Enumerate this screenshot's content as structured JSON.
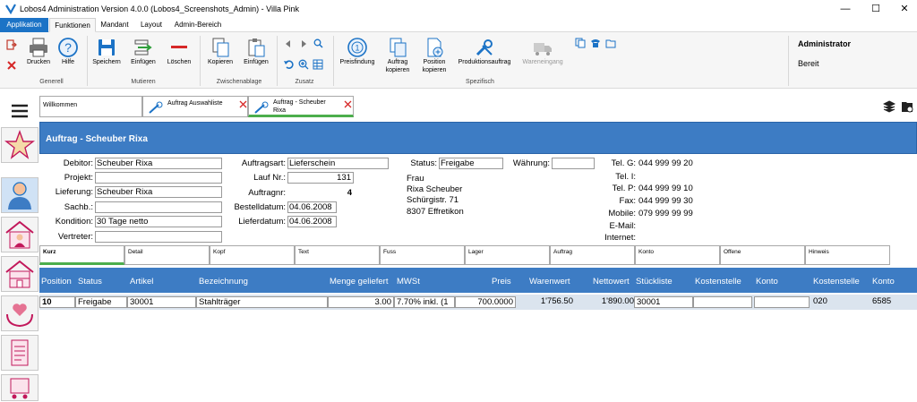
{
  "window": {
    "title": "Lobos4 Administration Version 4.0.0 (Lobos4_Screenshots_Admin) - Villa Pink",
    "minimize": "—",
    "maximize": "☐",
    "close": "✕"
  },
  "menu": {
    "tabs": [
      "Applikation",
      "Funktionen",
      "Mandant",
      "Layout",
      "Admin-Bereich"
    ]
  },
  "ribbon": {
    "buttons": {
      "drucken": "Drucken",
      "hilfe": "Hilfe",
      "speichern": "Speichern",
      "einfuegen": "Einfügen",
      "loeschen": "Löschen",
      "kopieren": "Kopieren",
      "einfuegen2": "Einfügen",
      "preisfindung": "Preisfindung",
      "auftrag_kopieren_1": "Auftrag",
      "auftrag_kopieren_2": "kopieren",
      "position_kopieren_1": "Position",
      "position_kopieren_2": "kopieren",
      "produktionsauftrag": "Produktionsauftrag",
      "wareneingang": "Wareneingang"
    },
    "groups": {
      "generell": "Generell",
      "mutieren": "Mutieren",
      "zwischenablage": "Zwischenablage",
      "zusatz": "Zusatz",
      "spezifisch": "Spezifisch"
    },
    "user": "Administrator",
    "status": "Bereit"
  },
  "doc_tabs": {
    "welcome": "Willkommen",
    "list": "Auftrag Auswahliste",
    "detail_1": "Auftrag - Scheuber",
    "detail_2": "Rixa"
  },
  "form": {
    "header": "Auftrag - Scheuber Rixa",
    "labels": {
      "debitor": "Debitor:",
      "projekt": "Projekt:",
      "lieferung": "Lieferung:",
      "sachb": "Sachb.:",
      "kondition": "Kondition:",
      "vertreter": "Vertreter:",
      "auftragsart": "Auftragsart:",
      "lauf_nr": "Lauf Nr.:",
      "auftragnr": "Auftragnr:",
      "bestelldatum": "Bestelldatum:",
      "lieferdatum": "Lieferdatum:",
      "status": "Status:",
      "waehrung": "Währung:",
      "tel_g": "Tel. G:",
      "tel_i": "Tel. I:",
      "tel_p": "Tel. P:",
      "fax": "Fax:",
      "mobile": "Mobile:",
      "email": "E-Mail:",
      "internet": "Internet:"
    },
    "values": {
      "debitor": "Scheuber Rixa",
      "projekt": "",
      "lieferung": "Scheuber Rixa",
      "sachb": "",
      "kondition": "30 Tage netto",
      "vertreter": "",
      "auftragsart": "Lieferschein",
      "lauf_nr": "131",
      "auftragnr": "4",
      "bestelldatum": "04.06.2008",
      "lieferdatum": "04.06.2008",
      "status": "Freigabe",
      "waehrung": "",
      "tel_g": "044 999 99 20",
      "tel_i": "",
      "tel_p": "044 999 99 10",
      "fax": "044 999 99 30",
      "mobile": "079 999 99 99",
      "email": "",
      "internet": ""
    },
    "address": [
      "Frau",
      "Rixa Scheuber",
      "Schürgistr. 71",
      "8307 Effretikon"
    ]
  },
  "sub_tabs": [
    "Kurz",
    "Detail",
    "Kopf",
    "Text",
    "Fuss",
    "Lager",
    "Auftrag",
    "Konto",
    "Offene",
    "Hinweis"
  ],
  "grid": {
    "columns": [
      "Position",
      "Status",
      "Artikel",
      "Bezeichnung",
      "Menge geliefert",
      "MWSt",
      "Preis",
      "Warenwert",
      "Nettowert",
      "Stückliste",
      "Kostenstelle",
      "Konto",
      "Kostenstelle",
      "Konto"
    ],
    "row": {
      "position": "10",
      "status": "Freigabe",
      "artikel": "30001",
      "bezeichnung": "Stahlträger",
      "menge": "3.00",
      "mwst": "7.70% inkl. (1",
      "preis": "700.0000",
      "warenwert": "1'756.50",
      "nettowert": "1'890.00",
      "stueckliste": "30001",
      "kostenstelle": "",
      "konto": "",
      "kostenstelle2": "020",
      "konto2": "6585"
    }
  },
  "colors": {
    "accent": "#1c73c6",
    "header_blue": "#3d7cc4",
    "row_bg": "#dbe4ee",
    "active_tab_underline": "#4cae4c"
  }
}
